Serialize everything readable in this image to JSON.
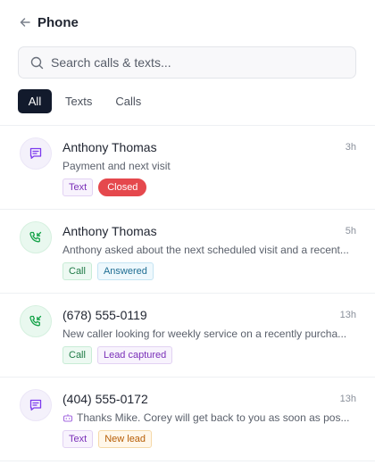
{
  "header": {
    "title": "Phone"
  },
  "search": {
    "placeholder": "Search calls & texts..."
  },
  "tabs": [
    {
      "label": "All",
      "active": true
    },
    {
      "label": "Texts",
      "active": false
    },
    {
      "label": "Calls",
      "active": false
    }
  ],
  "colors": {
    "active_tab": "#121a2c",
    "text_accent": "#7c3aed",
    "call_accent": "#16a34a",
    "closed_badge": "#e5484d"
  },
  "conversations": [
    {
      "kind": "text",
      "icon": "message-icon",
      "name": "Anthony Thomas",
      "time": "3h",
      "preview": "Payment and next visit",
      "badges": [
        "Text",
        "Closed"
      ]
    },
    {
      "kind": "call",
      "icon": "incoming-call-icon",
      "name": "Anthony Thomas",
      "time": "5h",
      "preview": "Anthony asked about the next scheduled visit and a recent...",
      "badges": [
        "Call",
        "Answered"
      ]
    },
    {
      "kind": "call",
      "icon": "incoming-call-icon",
      "name": "(678) 555-0119",
      "time": "13h",
      "preview": "New caller looking for weekly service on a recently purcha...",
      "badges": [
        "Call",
        "Lead captured"
      ]
    },
    {
      "kind": "text",
      "icon": "message-icon",
      "name": "(404) 555-0172",
      "time": "13h",
      "preview": "Thanks Mike. Corey will get back to you as soon as pos...",
      "preview_icon": "bot-icon",
      "badges": [
        "Text",
        "New lead"
      ]
    }
  ]
}
